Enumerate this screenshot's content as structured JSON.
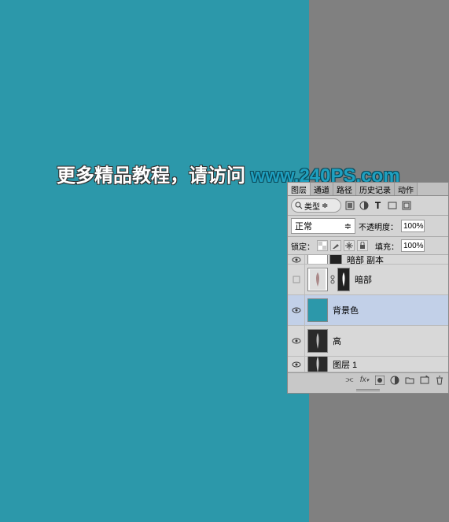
{
  "watermark": {
    "text_cn": "更多精品教程，请访问 ",
    "link": "www.240PS.com"
  },
  "panel": {
    "tabs": {
      "layers": "图层",
      "channels": "通道",
      "paths": "路径",
      "history": "历史记录",
      "actions": "动作"
    },
    "filter": {
      "kind_label": "类型"
    },
    "blend": {
      "mode": "正常",
      "opacity_label": "不透明度：",
      "opacity_value": "100%"
    },
    "lock": {
      "label": "锁定：",
      "fill_label": "填充：",
      "fill_value": "100%"
    },
    "layers": [
      {
        "name": "暗部 副本",
        "visible": true,
        "selected": false
      },
      {
        "name": "暗部",
        "visible": false,
        "selected": false
      },
      {
        "name": "背景色",
        "visible": true,
        "selected": true
      },
      {
        "name": "高",
        "visible": true,
        "selected": false
      },
      {
        "name": "图层 1",
        "visible": true,
        "selected": false
      }
    ],
    "icons": {
      "search": "search-icon",
      "image": "image-icon",
      "adjust": "adjust-icon",
      "text": "text-icon",
      "shape": "shape-icon",
      "smart": "smart-icon",
      "link": "link-icon",
      "fx": "fx-icon",
      "mask": "mask-icon",
      "fill": "fill-icon",
      "group": "group-icon",
      "new": "new-icon",
      "trash": "trash-icon"
    }
  }
}
